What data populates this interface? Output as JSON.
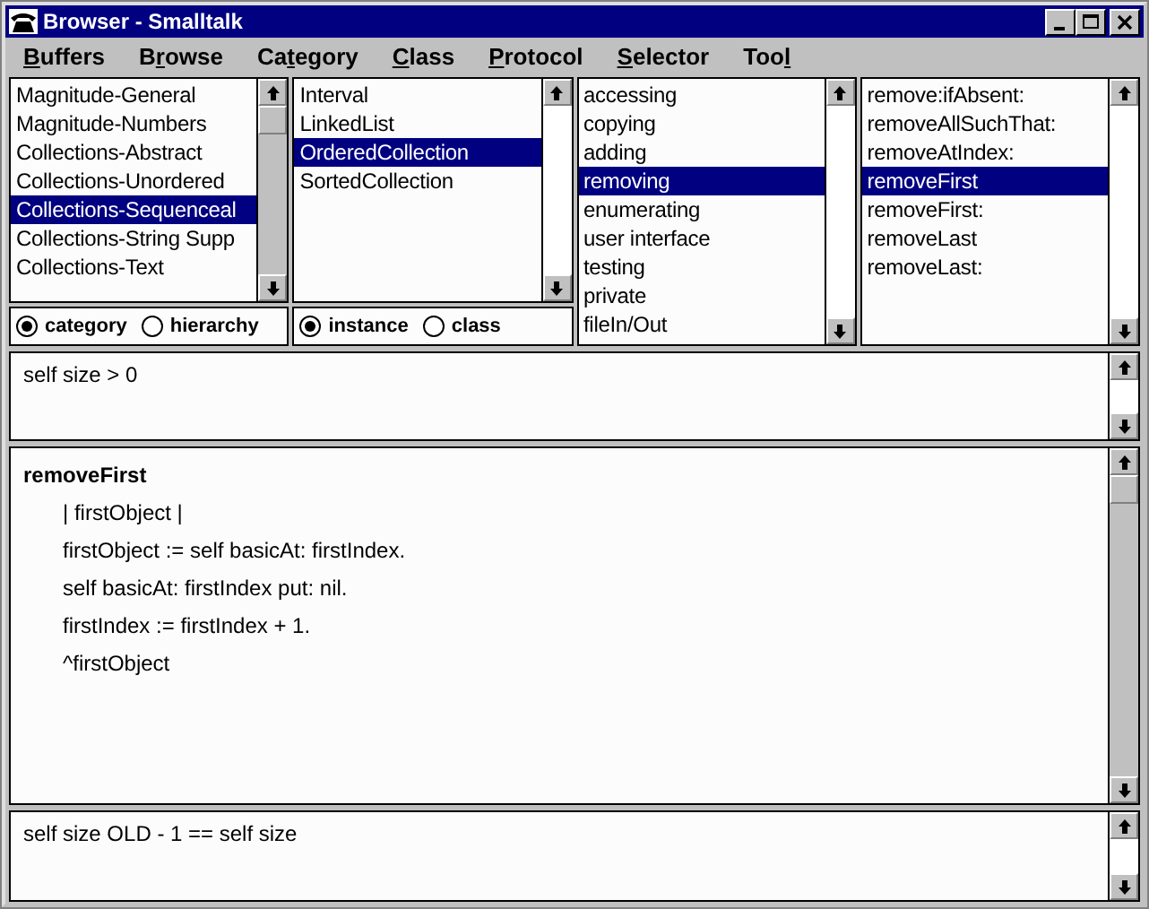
{
  "window": {
    "title": "Browser - Smalltalk"
  },
  "menu": [
    {
      "access_key": "B",
      "after": "uffers"
    },
    {
      "before": "B",
      "access_key": "r",
      "after": "owse"
    },
    {
      "before": "Ca",
      "access_key": "t",
      "after": "egory"
    },
    {
      "access_key": "C",
      "after": "lass"
    },
    {
      "access_key": "P",
      "after": "rotocol"
    },
    {
      "access_key": "S",
      "after": "elector"
    },
    {
      "before": "Too",
      "access_key": "l"
    }
  ],
  "panes": [
    {
      "items": [
        {
          "label": "Magnitude-General",
          "selected": false
        },
        {
          "label": "Magnitude-Numbers",
          "selected": false
        },
        {
          "label": "Collections-Abstract",
          "selected": false
        },
        {
          "label": "Collections-Unordered",
          "selected": false
        },
        {
          "label": "Collections-Sequenceal",
          "selected": true
        },
        {
          "label": "Collections-String Supp",
          "selected": false
        },
        {
          "label": "Collections-Text",
          "selected": false
        }
      ],
      "radios": [
        {
          "label": "category",
          "selected": true
        },
        {
          "label": "hierarchy",
          "selected": false
        }
      ]
    },
    {
      "items": [
        {
          "label": "Interval",
          "selected": false
        },
        {
          "label": "LinkedList",
          "selected": false
        },
        {
          "label": "OrderedCollection",
          "selected": true
        },
        {
          "label": "SortedCollection",
          "selected": false
        }
      ],
      "radios": [
        {
          "label": "instance",
          "selected": true
        },
        {
          "label": "class",
          "selected": false
        }
      ]
    },
    {
      "items": [
        {
          "label": "accessing",
          "selected": false
        },
        {
          "label": "copying",
          "selected": false
        },
        {
          "label": "adding",
          "selected": false
        },
        {
          "label": "removing",
          "selected": true
        },
        {
          "label": "enumerating",
          "selected": false
        },
        {
          "label": "user interface",
          "selected": false
        },
        {
          "label": "testing",
          "selected": false
        },
        {
          "label": "private",
          "selected": false
        },
        {
          "label": "fileIn/Out",
          "selected": false
        }
      ]
    },
    {
      "items": [
        {
          "label": "remove:ifAbsent:",
          "selected": false
        },
        {
          "label": "removeAllSuchThat:",
          "selected": false
        },
        {
          "label": "removeAtIndex:",
          "selected": false
        },
        {
          "label": "removeFirst",
          "selected": true
        },
        {
          "label": "removeFirst:",
          "selected": false
        },
        {
          "label": "removeLast",
          "selected": false
        },
        {
          "label": "removeLast:",
          "selected": false
        }
      ]
    }
  ],
  "precondition": "self size > 0",
  "method": {
    "selector": "removeFirst",
    "lines": [
      "| firstObject |",
      "firstObject := self basicAt: firstIndex.",
      "self basicAt: firstIndex put: nil.",
      "firstIndex := firstIndex + 1.",
      "^firstObject"
    ]
  },
  "postcondition": "self size OLD - 1 == self size"
}
